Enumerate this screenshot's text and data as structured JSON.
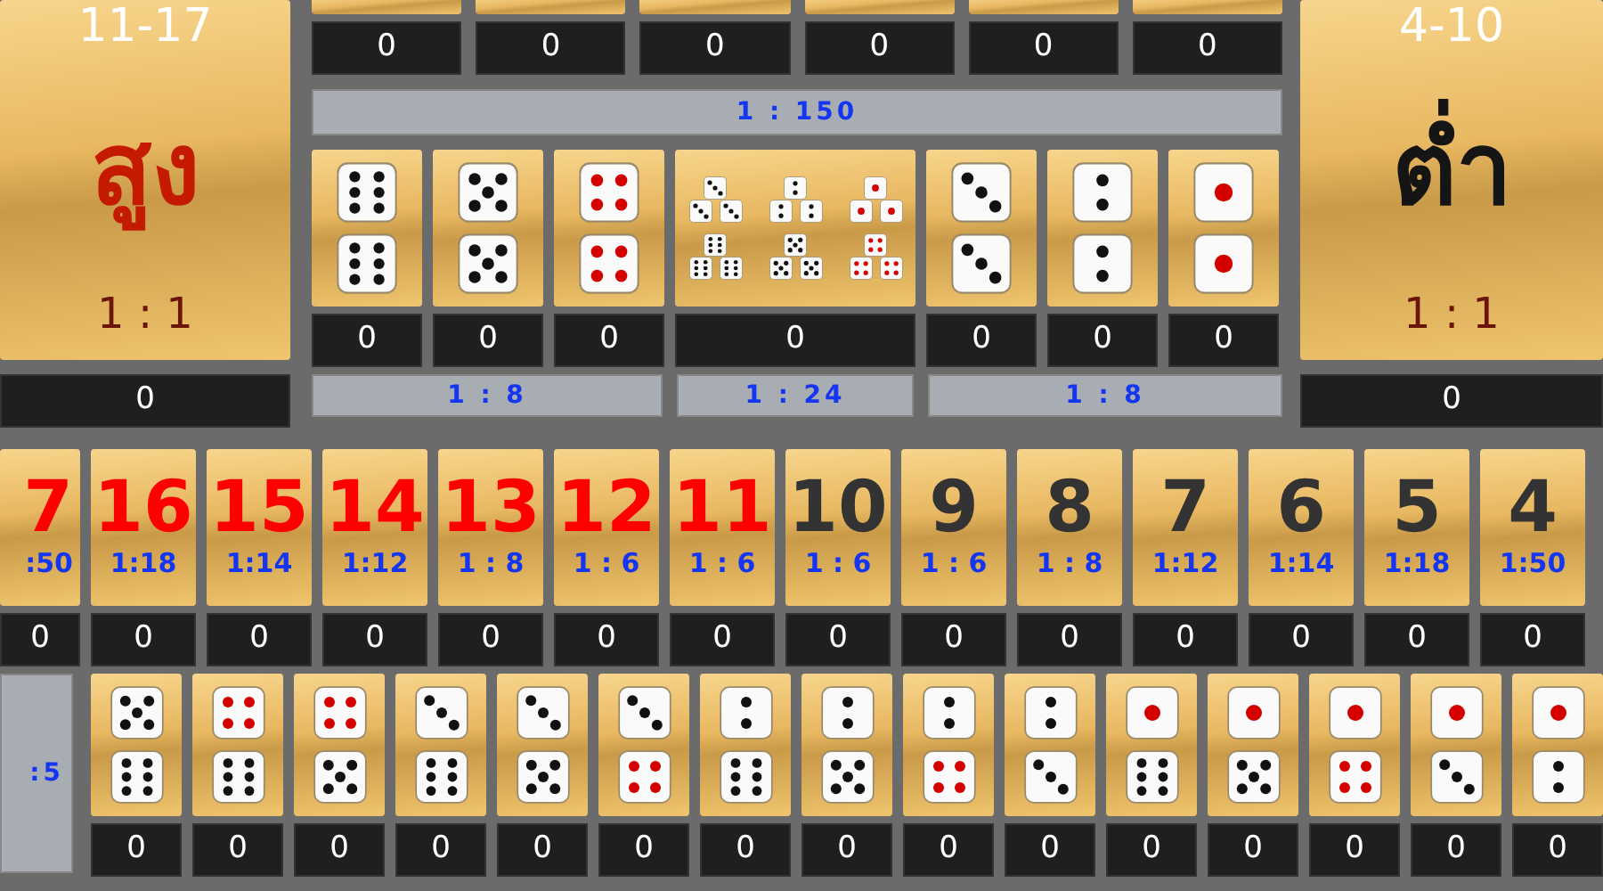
{
  "high_bet": {
    "range": "11-17",
    "label": "สูง",
    "odds": "1 : 1",
    "bet": "0"
  },
  "top_row_bets": [
    "0",
    "0",
    "0",
    "0",
    "0",
    "0"
  ],
  "triple_odds": "1 : 150",
  "pair_bets": [
    {
      "kind": "pair",
      "dice": [
        {
          "kind": "six"
        },
        {
          "kind": "six"
        }
      ],
      "bet": "0"
    },
    {
      "kind": "pair",
      "dice": [
        {
          "kind": "five"
        },
        {
          "kind": "five"
        }
      ],
      "bet": "0"
    },
    {
      "kind": "pair",
      "dice": [
        {
          "kind": "four"
        },
        {
          "kind": "four"
        }
      ],
      "bet": "0"
    },
    {
      "kind": "any_triple",
      "dice": [
        [
          {
            "kind": "three"
          },
          {
            "kind": "three"
          },
          {
            "kind": "three"
          }
        ],
        [
          {
            "kind": "two"
          },
          {
            "kind": "two"
          },
          {
            "kind": "two"
          }
        ],
        [
          {
            "kind": "one"
          },
          {
            "kind": "one"
          },
          {
            "kind": "one"
          }
        ],
        [
          {
            "kind": "six"
          },
          {
            "kind": "six"
          },
          {
            "kind": "six"
          }
        ],
        [
          {
            "kind": "five"
          },
          {
            "kind": "five"
          },
          {
            "kind": "five"
          }
        ],
        [
          {
            "kind": "four"
          },
          {
            "kind": "four"
          },
          {
            "kind": "four"
          }
        ]
      ],
      "bet": "0"
    },
    {
      "kind": "pair",
      "dice": [
        {
          "kind": "three"
        },
        {
          "kind": "three"
        }
      ],
      "bet": "0"
    },
    {
      "kind": "pair",
      "dice": [
        {
          "kind": "two"
        },
        {
          "kind": "two"
        }
      ],
      "bet": "0"
    },
    {
      "kind": "pair",
      "dice": [
        {
          "kind": "one"
        },
        {
          "kind": "one"
        }
      ],
      "bet": "0"
    }
  ],
  "pair_odds": [
    "1 : 8",
    "1 : 24",
    "1 : 8"
  ],
  "low_bet": {
    "range": "4-10",
    "label": "ต่ำ",
    "odds": "1 : 1",
    "bet": "0"
  },
  "totals": [
    {
      "total": "7",
      "odds": ":50",
      "color": "#ff0000",
      "bet": "0"
    },
    {
      "total": "16",
      "odds": "1:18",
      "color": "#ff0000",
      "bet": "0"
    },
    {
      "total": "15",
      "odds": "1:14",
      "color": "#ff0000",
      "bet": "0"
    },
    {
      "total": "14",
      "odds": "1:12",
      "color": "#ff0000",
      "bet": "0"
    },
    {
      "total": "13",
      "odds": "1 : 8",
      "color": "#ff0000",
      "bet": "0"
    },
    {
      "total": "12",
      "odds": "1 : 6",
      "color": "#ff0000",
      "bet": "0"
    },
    {
      "total": "11",
      "odds": "1 : 6",
      "color": "#ff0000",
      "bet": "0"
    },
    {
      "total": "10",
      "odds": "1 : 6",
      "color": "#333333",
      "bet": "0"
    },
    {
      "total": "9",
      "odds": "1 : 6",
      "color": "#333333",
      "bet": "0"
    },
    {
      "total": "8",
      "odds": "1 : 8",
      "color": "#333333",
      "bet": "0"
    },
    {
      "total": "7",
      "odds": "1:12",
      "color": "#333333",
      "bet": "0"
    },
    {
      "total": "6",
      "odds": "1:14",
      "color": "#333333",
      "bet": "0"
    },
    {
      "total": "5",
      "odds": "1:18",
      "color": "#333333",
      "bet": "0"
    },
    {
      "total": "4",
      "odds": "1:50",
      "color": "#333333",
      "bet": "0"
    }
  ],
  "combo_odds": ":5",
  "combos": [
    {
      "dice": [
        {
          "kind": "five"
        },
        {
          "kind": "six"
        }
      ],
      "bet": "0"
    },
    {
      "dice": [
        {
          "kind": "four"
        },
        {
          "kind": "six"
        }
      ],
      "bet": "0"
    },
    {
      "dice": [
        {
          "kind": "four"
        },
        {
          "kind": "five"
        }
      ],
      "bet": "0"
    },
    {
      "dice": [
        {
          "kind": "three"
        },
        {
          "kind": "six"
        }
      ],
      "bet": "0"
    },
    {
      "dice": [
        {
          "kind": "three"
        },
        {
          "kind": "five"
        }
      ],
      "bet": "0"
    },
    {
      "dice": [
        {
          "kind": "three"
        },
        {
          "kind": "four"
        }
      ],
      "bet": "0"
    },
    {
      "dice": [
        {
          "kind": "two"
        },
        {
          "kind": "six"
        }
      ],
      "bet": "0"
    },
    {
      "dice": [
        {
          "kind": "two"
        },
        {
          "kind": "five"
        }
      ],
      "bet": "0"
    },
    {
      "dice": [
        {
          "kind": "two"
        },
        {
          "kind": "four"
        }
      ],
      "bet": "0"
    },
    {
      "dice": [
        {
          "kind": "two"
        },
        {
          "kind": "three"
        }
      ],
      "bet": "0"
    },
    {
      "dice": [
        {
          "kind": "one"
        },
        {
          "kind": "six"
        }
      ],
      "bet": "0"
    },
    {
      "dice": [
        {
          "kind": "one"
        },
        {
          "kind": "five"
        }
      ],
      "bet": "0"
    },
    {
      "dice": [
        {
          "kind": "one"
        },
        {
          "kind": "four"
        }
      ],
      "bet": "0"
    },
    {
      "dice": [
        {
          "kind": "one"
        },
        {
          "kind": "three"
        }
      ],
      "bet": "0"
    },
    {
      "dice": [
        {
          "kind": "one"
        },
        {
          "kind": "two"
        }
      ],
      "bet": "0"
    }
  ]
}
